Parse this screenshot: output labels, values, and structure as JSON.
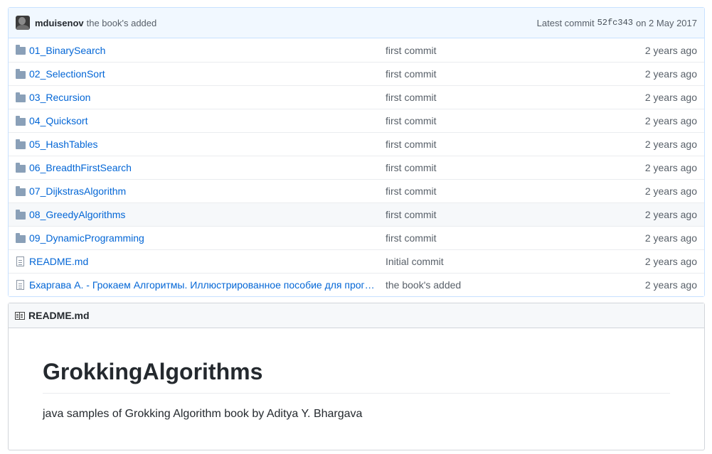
{
  "commit": {
    "author": "mduisenov",
    "message": "the book's added",
    "latest_label": "Latest commit",
    "sha": "52fc343",
    "date_label": "on 2 May 2017"
  },
  "files": [
    {
      "type": "folder",
      "name": "01_BinarySearch",
      "message": "first commit",
      "age": "2 years ago"
    },
    {
      "type": "folder",
      "name": "02_SelectionSort",
      "message": "first commit",
      "age": "2 years ago"
    },
    {
      "type": "folder",
      "name": "03_Recursion",
      "message": "first commit",
      "age": "2 years ago"
    },
    {
      "type": "folder",
      "name": "04_Quicksort",
      "message": "first commit",
      "age": "2 years ago"
    },
    {
      "type": "folder",
      "name": "05_HashTables",
      "message": "first commit",
      "age": "2 years ago"
    },
    {
      "type": "folder",
      "name": "06_BreadthFirstSearch",
      "message": "first commit",
      "age": "2 years ago"
    },
    {
      "type": "folder",
      "name": "07_DijkstrasAlgorithm",
      "message": "first commit",
      "age": "2 years ago"
    },
    {
      "type": "folder",
      "name": "08_GreedyAlgorithms",
      "message": "first commit",
      "age": "2 years ago"
    },
    {
      "type": "folder",
      "name": "09_DynamicProgramming",
      "message": "first commit",
      "age": "2 years ago"
    },
    {
      "type": "file",
      "name": "README.md",
      "message": "Initial commit",
      "age": "2 years ago"
    },
    {
      "type": "file",
      "name": "Бхаргава А. - Грокаем Алгоритмы. Иллюстрированное пособие для програм…",
      "message": "the book's added",
      "age": "2 years ago"
    }
  ],
  "readme": {
    "header": "README.md",
    "title": "GrokkingAlgorithms",
    "description": "java samples of Grokking Algorithm book by Aditya Y. Bhargava"
  },
  "icons": {
    "avatar": "avatar",
    "folder": "folder-icon",
    "file": "file-icon",
    "readme": "book-icon"
  },
  "colors": {
    "link": "#0366d6",
    "commit_bar": "#f1f8ff",
    "muted": "#586069"
  }
}
